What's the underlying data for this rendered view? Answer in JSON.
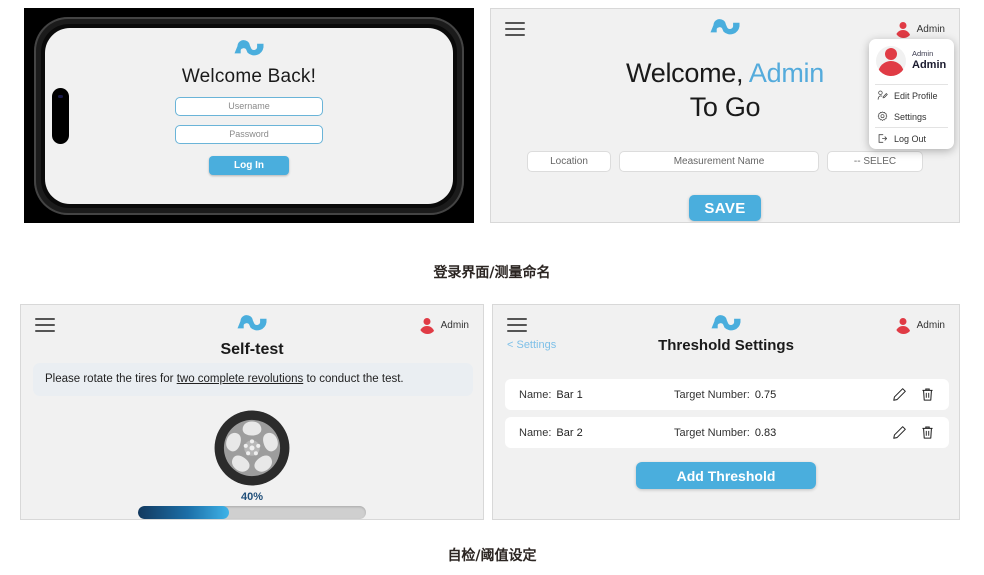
{
  "brand": {
    "logo_icon": "wave-logo-icon",
    "accent_blue": "#4aaedd",
    "avatar_red": "#e03b45"
  },
  "captions": {
    "top": "登录界面/测量命名",
    "bottom": "自检/阈值设定"
  },
  "login_screen": {
    "title": "Welcome Back!",
    "username_placeholder": "Username",
    "password_placeholder": "Password",
    "login_button": "Log In"
  },
  "measure_screen": {
    "menu_icon": "hamburger-menu-icon",
    "user_label": "Admin",
    "heading_line1_static": "Welcome, ",
    "heading_line1_name": "Admin",
    "heading_line2": "To Go",
    "fields": {
      "location_placeholder": "Location",
      "measurement_placeholder": "Measurement Name",
      "select_value": "-- SELEC"
    },
    "save_button": "SAVE",
    "dropdown": {
      "name_small": "Admin",
      "name_bold": "Admin",
      "items": [
        {
          "label": "Edit Profile",
          "icon": "edit-profile-icon"
        },
        {
          "label": "Settings",
          "icon": "gear-icon"
        },
        {
          "label": "Log Out",
          "icon": "logout-icon"
        }
      ]
    }
  },
  "selftest_screen": {
    "user_label": "Admin",
    "title": "Self-test",
    "instruction_pre": "Please rotate the tires for ",
    "instruction_emph": "two complete revolutions",
    "instruction_post": " to conduct the test.",
    "progress_label": "40%",
    "progress_percent": 40,
    "tire_icon": "tire-wheel-icon"
  },
  "threshold_screen": {
    "user_label": "Admin",
    "back_link": "< Settings",
    "title": "Threshold Settings",
    "name_label": "Name:",
    "target_label": "Target Number:",
    "rows": [
      {
        "name": "Bar 1",
        "target": "0.75",
        "edit_icon": "pencil-icon",
        "delete_icon": "trash-icon"
      },
      {
        "name": "Bar 2",
        "target": "0.83",
        "edit_icon": "pencil-icon",
        "delete_icon": "trash-icon"
      }
    ],
    "add_button": "Add Threshold"
  }
}
